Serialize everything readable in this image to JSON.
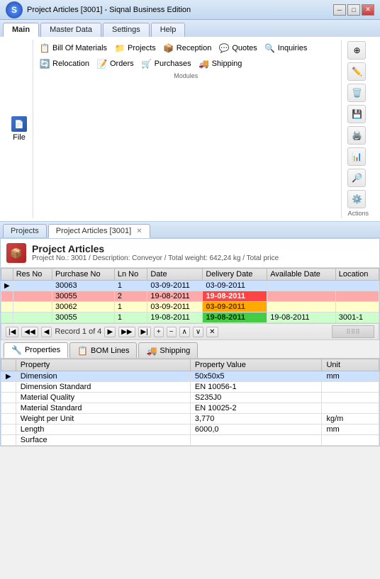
{
  "window": {
    "title": "Project Articles [3001] - Siqnal Business Edition",
    "minimize_label": "─",
    "maximize_label": "□",
    "close_label": "✕"
  },
  "ribbon": {
    "tabs": [
      "Main",
      "Master Data",
      "Settings",
      "Help"
    ],
    "active_tab": "Main",
    "modules_label": "Modules",
    "actions_label": "Actions",
    "file_label": "File",
    "items": {
      "bill_of_materials": "Bill Of Materials",
      "quotes": "Quotes",
      "orders": "Orders",
      "projects": "Projects",
      "inquiries": "Inquiries",
      "purchases": "Purchases",
      "reception": "Reception",
      "relocation": "Relocation",
      "shipping": "Shipping"
    }
  },
  "tabs": {
    "projects_tab": "Projects",
    "project_articles_tab": "Project Articles [3001]"
  },
  "article_header": {
    "title": "Project Articles",
    "subtitle": "Project No.: 3001 / Description: Conveyor / Total weight: 642,24 kg / Total price"
  },
  "table": {
    "columns": [
      "Res No",
      "Purchase No",
      "Ln No",
      "Date",
      "Delivery Date",
      "Available Date",
      "Location"
    ],
    "rows": [
      {
        "res_no": "",
        "purchase_no": "30063",
        "ln_no": "1",
        "date": "03-09-2011",
        "delivery_date": "03-09-2011",
        "available_date": "",
        "location": "",
        "style": "normal",
        "selected": true
      },
      {
        "res_no": "",
        "purchase_no": "30055",
        "ln_no": "2",
        "date": "19-08-2011",
        "delivery_date": "19-08-2011",
        "available_date": "",
        "location": "",
        "style": "red"
      },
      {
        "res_no": "",
        "purchase_no": "30062",
        "ln_no": "1",
        "date": "03-09-2011",
        "delivery_date": "03-09-2011",
        "available_date": "",
        "location": "",
        "style": "yellow"
      },
      {
        "res_no": "",
        "purchase_no": "30055",
        "ln_no": "1",
        "date": "19-08-2011",
        "delivery_date": "19-08-2011",
        "available_date": "19-08-2011",
        "location": "3001-1",
        "style": "green"
      }
    ]
  },
  "nav": {
    "record_text": "Record 1 of 4"
  },
  "bottom_tabs": {
    "properties_label": "Properties",
    "bom_lines_label": "BOM Lines",
    "shipping_label": "Shipping"
  },
  "properties": {
    "columns": [
      "Property",
      "Property Value",
      "Unit"
    ],
    "rows": [
      {
        "property": "Dimension",
        "value": "50x50x5",
        "unit": "mm",
        "selected": true
      },
      {
        "property": "Dimension Standard",
        "value": "EN 10056-1",
        "unit": ""
      },
      {
        "property": "Material Quality",
        "value": "S235J0",
        "unit": ""
      },
      {
        "property": "Material Standard",
        "value": "EN 10025-2",
        "unit": ""
      },
      {
        "property": "Weight per Unit",
        "value": "3,770",
        "unit": "kg/m"
      },
      {
        "property": "Length",
        "value": "6000,0",
        "unit": "mm"
      },
      {
        "property": "Surface",
        "value": "",
        "unit": ""
      }
    ]
  }
}
